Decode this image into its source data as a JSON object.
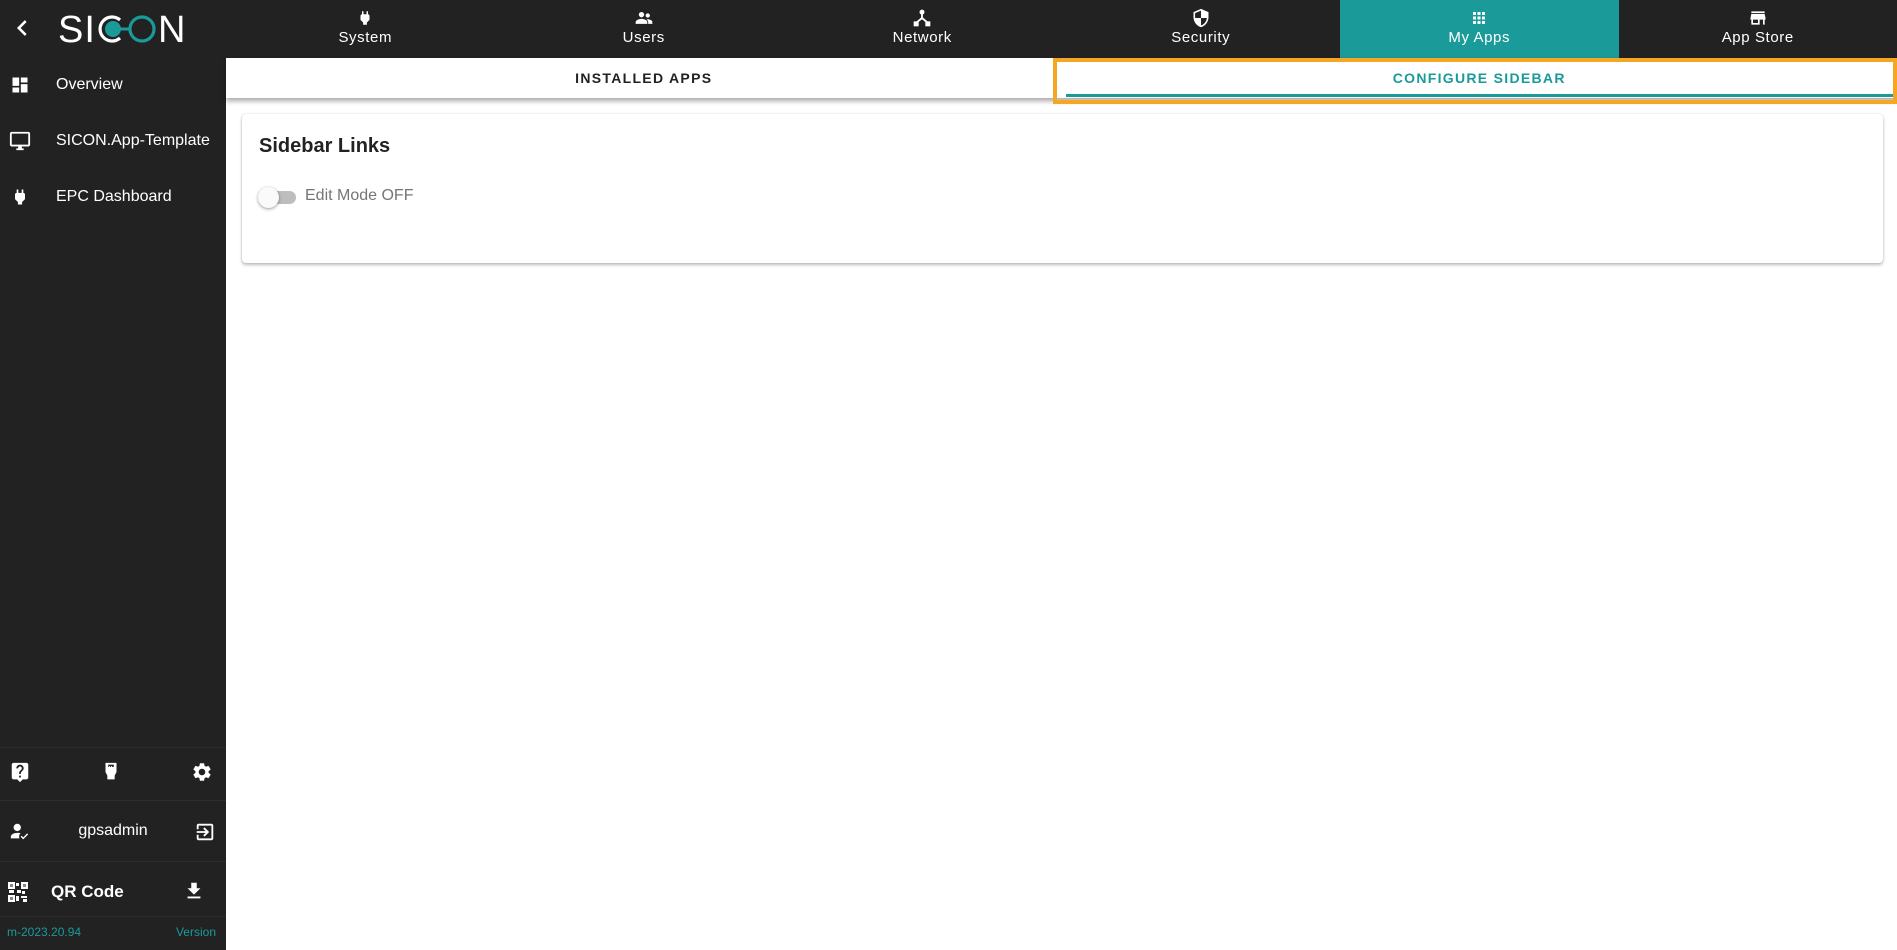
{
  "brand": {
    "logo_text": "SICON",
    "accent_color": "#1b9a9a",
    "highlight_color": "#f5a623",
    "sidebar_bg": "#222222"
  },
  "sidebar": {
    "back_icon": "chevron-left-icon",
    "items": [
      {
        "label": "Overview",
        "icon": "dashboard-icon"
      },
      {
        "label": "SICON.App-Template",
        "icon": "monitor-icon"
      },
      {
        "label": "EPC Dashboard",
        "icon": "plug-icon"
      }
    ],
    "tools": [
      {
        "name": "help",
        "icon": "help-icon"
      },
      {
        "name": "ethernet",
        "icon": "ethernet-icon"
      },
      {
        "name": "settings",
        "icon": "gear-icon"
      }
    ],
    "user": {
      "name": "gpsadmin",
      "icon": "user-check-icon",
      "logout_icon": "logout-icon"
    },
    "qr": {
      "label": "QR Code",
      "icon": "qr-code-icon",
      "download_icon": "download-icon"
    },
    "version": {
      "value": "m-2023.20.94",
      "link_label": "Version"
    }
  },
  "topnav": {
    "tabs": [
      {
        "label": "System",
        "icon": "plug-icon",
        "active": false
      },
      {
        "label": "Users",
        "icon": "users-icon",
        "active": false
      },
      {
        "label": "Network",
        "icon": "network-icon",
        "active": false
      },
      {
        "label": "Security",
        "icon": "shield-icon",
        "active": false
      },
      {
        "label": "My Apps",
        "icon": "apps-grid-icon",
        "active": true
      },
      {
        "label": "App Store",
        "icon": "store-icon",
        "active": false
      }
    ]
  },
  "subtabs": {
    "tabs": [
      {
        "label": "INSTALLED APPS",
        "active": false
      },
      {
        "label": "CONFIGURE SIDEBAR",
        "active": true
      }
    ]
  },
  "card": {
    "title": "Sidebar Links",
    "toggle": {
      "label": "Edit Mode OFF",
      "checked": false
    }
  }
}
